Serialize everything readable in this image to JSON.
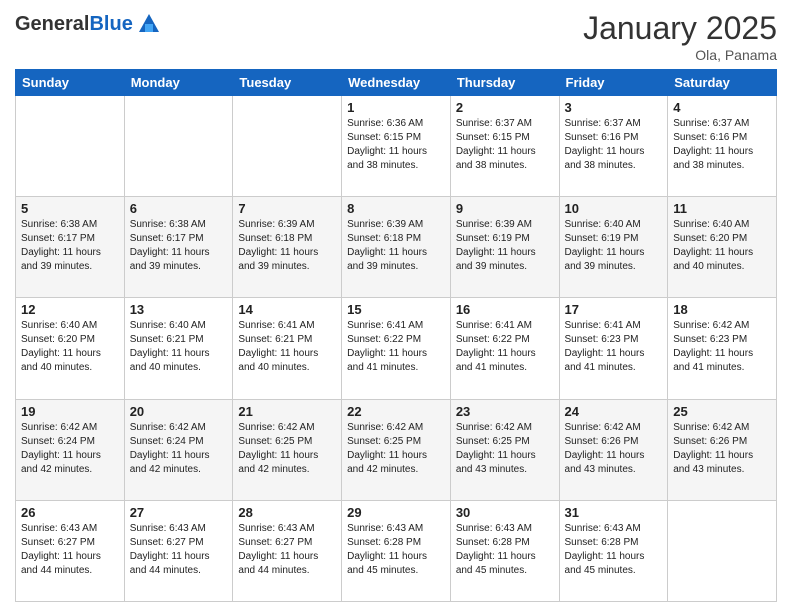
{
  "logo": {
    "general": "General",
    "blue": "Blue"
  },
  "header": {
    "month": "January 2025",
    "location": "Ola, Panama"
  },
  "days": [
    "Sunday",
    "Monday",
    "Tuesday",
    "Wednesday",
    "Thursday",
    "Friday",
    "Saturday"
  ],
  "weeks": [
    [
      {
        "day": "",
        "info": ""
      },
      {
        "day": "",
        "info": ""
      },
      {
        "day": "",
        "info": ""
      },
      {
        "day": "1",
        "info": "Sunrise: 6:36 AM\nSunset: 6:15 PM\nDaylight: 11 hours and 38 minutes."
      },
      {
        "day": "2",
        "info": "Sunrise: 6:37 AM\nSunset: 6:15 PM\nDaylight: 11 hours and 38 minutes."
      },
      {
        "day": "3",
        "info": "Sunrise: 6:37 AM\nSunset: 6:16 PM\nDaylight: 11 hours and 38 minutes."
      },
      {
        "day": "4",
        "info": "Sunrise: 6:37 AM\nSunset: 6:16 PM\nDaylight: 11 hours and 38 minutes."
      }
    ],
    [
      {
        "day": "5",
        "info": "Sunrise: 6:38 AM\nSunset: 6:17 PM\nDaylight: 11 hours and 39 minutes."
      },
      {
        "day": "6",
        "info": "Sunrise: 6:38 AM\nSunset: 6:17 PM\nDaylight: 11 hours and 39 minutes."
      },
      {
        "day": "7",
        "info": "Sunrise: 6:39 AM\nSunset: 6:18 PM\nDaylight: 11 hours and 39 minutes."
      },
      {
        "day": "8",
        "info": "Sunrise: 6:39 AM\nSunset: 6:18 PM\nDaylight: 11 hours and 39 minutes."
      },
      {
        "day": "9",
        "info": "Sunrise: 6:39 AM\nSunset: 6:19 PM\nDaylight: 11 hours and 39 minutes."
      },
      {
        "day": "10",
        "info": "Sunrise: 6:40 AM\nSunset: 6:19 PM\nDaylight: 11 hours and 39 minutes."
      },
      {
        "day": "11",
        "info": "Sunrise: 6:40 AM\nSunset: 6:20 PM\nDaylight: 11 hours and 40 minutes."
      }
    ],
    [
      {
        "day": "12",
        "info": "Sunrise: 6:40 AM\nSunset: 6:20 PM\nDaylight: 11 hours and 40 minutes."
      },
      {
        "day": "13",
        "info": "Sunrise: 6:40 AM\nSunset: 6:21 PM\nDaylight: 11 hours and 40 minutes."
      },
      {
        "day": "14",
        "info": "Sunrise: 6:41 AM\nSunset: 6:21 PM\nDaylight: 11 hours and 40 minutes."
      },
      {
        "day": "15",
        "info": "Sunrise: 6:41 AM\nSunset: 6:22 PM\nDaylight: 11 hours and 41 minutes."
      },
      {
        "day": "16",
        "info": "Sunrise: 6:41 AM\nSunset: 6:22 PM\nDaylight: 11 hours and 41 minutes."
      },
      {
        "day": "17",
        "info": "Sunrise: 6:41 AM\nSunset: 6:23 PM\nDaylight: 11 hours and 41 minutes."
      },
      {
        "day": "18",
        "info": "Sunrise: 6:42 AM\nSunset: 6:23 PM\nDaylight: 11 hours and 41 minutes."
      }
    ],
    [
      {
        "day": "19",
        "info": "Sunrise: 6:42 AM\nSunset: 6:24 PM\nDaylight: 11 hours and 42 minutes."
      },
      {
        "day": "20",
        "info": "Sunrise: 6:42 AM\nSunset: 6:24 PM\nDaylight: 11 hours and 42 minutes."
      },
      {
        "day": "21",
        "info": "Sunrise: 6:42 AM\nSunset: 6:25 PM\nDaylight: 11 hours and 42 minutes."
      },
      {
        "day": "22",
        "info": "Sunrise: 6:42 AM\nSunset: 6:25 PM\nDaylight: 11 hours and 42 minutes."
      },
      {
        "day": "23",
        "info": "Sunrise: 6:42 AM\nSunset: 6:25 PM\nDaylight: 11 hours and 43 minutes."
      },
      {
        "day": "24",
        "info": "Sunrise: 6:42 AM\nSunset: 6:26 PM\nDaylight: 11 hours and 43 minutes."
      },
      {
        "day": "25",
        "info": "Sunrise: 6:42 AM\nSunset: 6:26 PM\nDaylight: 11 hours and 43 minutes."
      }
    ],
    [
      {
        "day": "26",
        "info": "Sunrise: 6:43 AM\nSunset: 6:27 PM\nDaylight: 11 hours and 44 minutes."
      },
      {
        "day": "27",
        "info": "Sunrise: 6:43 AM\nSunset: 6:27 PM\nDaylight: 11 hours and 44 minutes."
      },
      {
        "day": "28",
        "info": "Sunrise: 6:43 AM\nSunset: 6:27 PM\nDaylight: 11 hours and 44 minutes."
      },
      {
        "day": "29",
        "info": "Sunrise: 6:43 AM\nSunset: 6:28 PM\nDaylight: 11 hours and 45 minutes."
      },
      {
        "day": "30",
        "info": "Sunrise: 6:43 AM\nSunset: 6:28 PM\nDaylight: 11 hours and 45 minutes."
      },
      {
        "day": "31",
        "info": "Sunrise: 6:43 AM\nSunset: 6:28 PM\nDaylight: 11 hours and 45 minutes."
      },
      {
        "day": "",
        "info": ""
      }
    ]
  ]
}
